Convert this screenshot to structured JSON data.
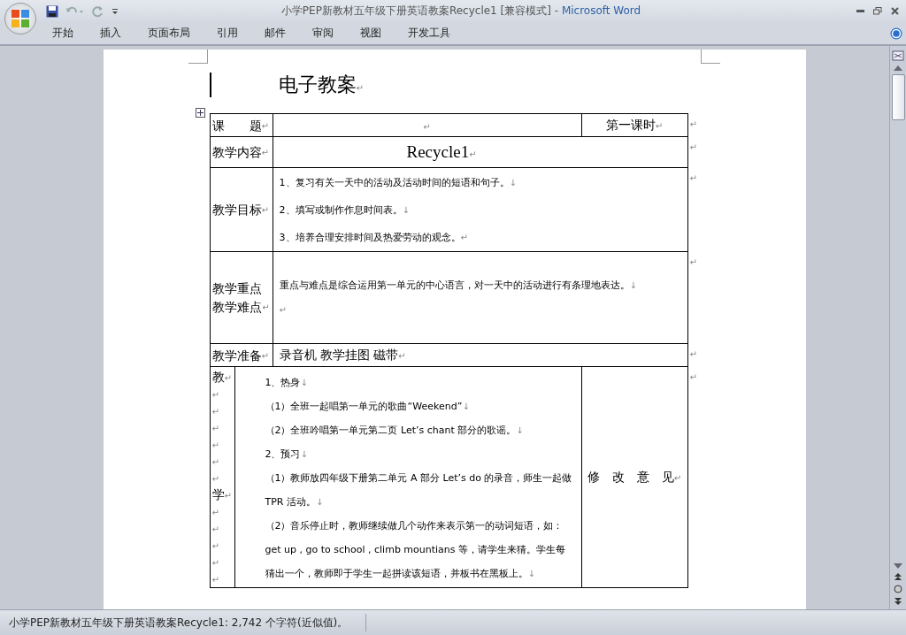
{
  "window": {
    "title_doc": "小学PEP新教材五年级下册英语教案Recycle1 [兼容模式]",
    "title_sep": "-",
    "title_app": "Microsoft Word"
  },
  "ribbon_tabs": [
    {
      "label": "开始",
      "selected": false
    },
    {
      "label": "插入",
      "selected": false
    },
    {
      "label": "页面布局",
      "selected": false
    },
    {
      "label": "引用",
      "selected": false
    },
    {
      "label": "邮件",
      "selected": false
    },
    {
      "label": "审阅",
      "selected": false
    },
    {
      "label": "视图",
      "selected": false
    },
    {
      "label": "开发工具",
      "selected": false
    }
  ],
  "document": {
    "heading": {
      "text": "电子教案",
      "mark": "↵"
    },
    "rows": [
      {
        "kind": "title",
        "label": {
          "text": "课　　题",
          "mark": "↵"
        },
        "content": [
          {
            "mark": "↵"
          }
        ],
        "side": {
          "text": "第一课时",
          "mark": "↵"
        },
        "end_mark": "↵"
      },
      {
        "kind": "big",
        "label": {
          "text": "教学内容",
          "mark": "↵"
        },
        "content": [
          {
            "text": "Recycle1",
            "mark": "↵"
          }
        ],
        "end_mark": "↵"
      },
      {
        "kind": "list",
        "label": {
          "text": "教学目标",
          "mark": "↵"
        },
        "content": [
          {
            "text": "1、复习有关一天中的活动及活动时间的短语和句子。",
            "mark": "↓"
          },
          {
            "text": "2、填写或制作作息时间表。",
            "mark": "↓"
          },
          {
            "text": "3、培养合理安排时间及热爱劳动的观念。",
            "mark": "↵"
          }
        ],
        "end_mark": "↵"
      },
      {
        "kind": "tall",
        "label": {
          "text": "教学重点教学难点",
          "mark": "↵"
        },
        "content": [
          {
            "text": "重点与难点是综合运用第一单元的中心语言，对一天中的活动进行有条理地表达。",
            "mark": "↓"
          },
          {
            "mark": "↵"
          }
        ],
        "end_mark": "↵"
      },
      {
        "kind": "plain",
        "label": {
          "text": "教学准备",
          "mark": "↵"
        },
        "content": [
          {
            "text": "录音机 教学挂图 磁带",
            "mark": "↵"
          }
        ],
        "end_mark": "↵"
      }
    ],
    "process": {
      "label_lines": [
        {
          "text": "教",
          "mark": "↵"
        },
        {
          "mark": "↵"
        },
        {
          "mark": "↵"
        },
        {
          "mark": "↵"
        },
        {
          "mark": "↵"
        },
        {
          "mark": "↵"
        },
        {
          "mark": "↵"
        },
        {
          "text": "学",
          "mark": "↵"
        },
        {
          "mark": "↵"
        },
        {
          "mark": "↵"
        },
        {
          "mark": "↵"
        },
        {
          "mark": "↵"
        },
        {
          "mark": "↵"
        }
      ],
      "content": [
        {
          "text": "1、热身",
          "mark": "↓"
        },
        {
          "text": "（1）全班一起唱第一单元的歌曲“Weekend”",
          "mark": "↓"
        },
        {
          "text": "（2）全班吟唱第一单元第二页 Let’s chant  部分的歌谣。",
          "mark": "↓"
        },
        {
          "text": "2、预习",
          "mark": "↓"
        },
        {
          "text": "（1）教师放四年级下册第二单元 A 部分 Let’s  do 的录音，师生一起做 TPR 活动。",
          "mark": "↓"
        },
        {
          "text": "（2）音乐停止时，教师继续做几个动作来表示第一的动词短语，如：get up , go to school , climb mountians 等，请学生来猜。学生每猜出一个，教师即于学生一起拼读该短语，并板书在黑板上。",
          "mark": "↓"
        }
      ],
      "side": {
        "text": "修　改　意　见",
        "mark": "↵"
      },
      "end_mark": "↵"
    }
  },
  "status_bar": {
    "text": "小学PEP新教材五年级下册英语教案Recycle1: 2,742 个字符(近似值)。"
  }
}
